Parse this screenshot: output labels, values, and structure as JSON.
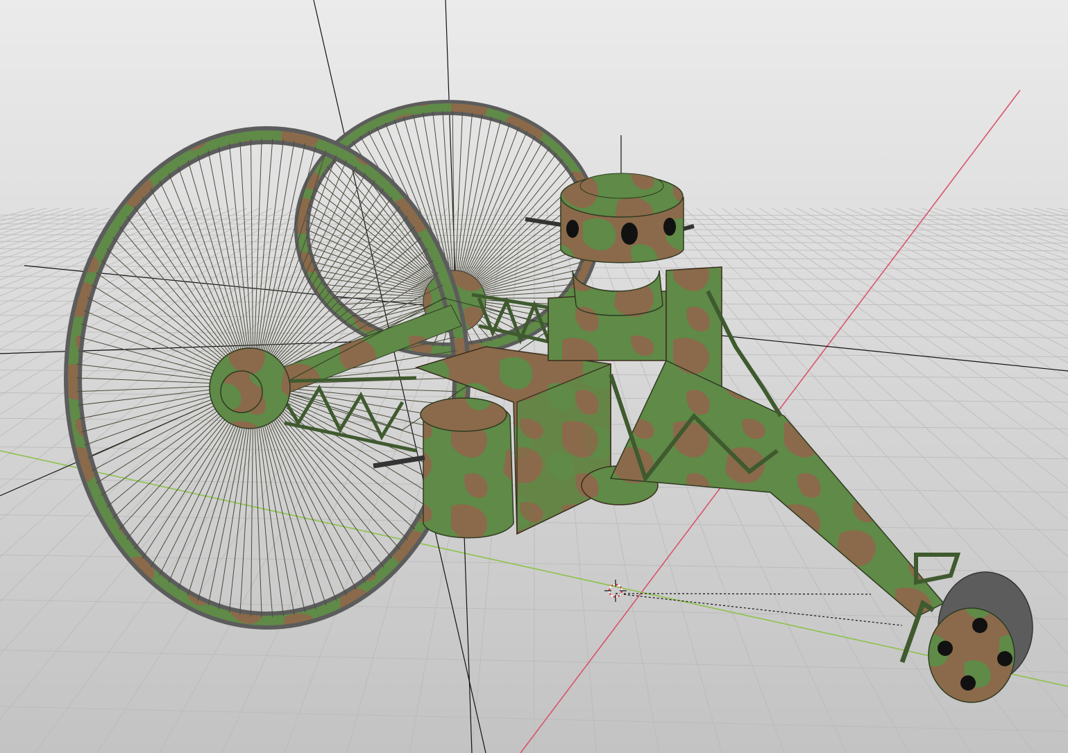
{
  "viewport": {
    "background_top": "#e8e8e8",
    "background_bottom": "#c4c4c4",
    "grid_color": "#b9b9b9",
    "x_axis_color": "#d8546b",
    "y_axis_color": "#8cc24a",
    "object_origin_marker": "3d-cursor-icon"
  },
  "model": {
    "camo_green": "#5f8a47",
    "camo_brown": "#8a6a4a",
    "dark_rim": "#5c5c5c",
    "spoke_color": "#4a4a3a",
    "empty_axes_color": "#111111"
  }
}
